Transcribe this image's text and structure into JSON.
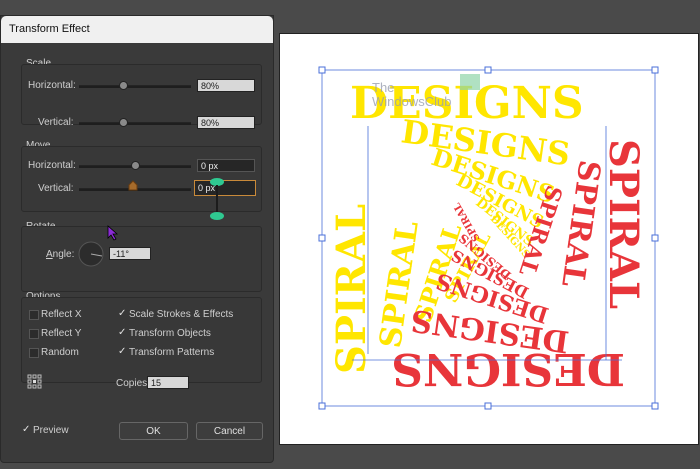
{
  "dialog": {
    "title": "Transform Effect",
    "scale": {
      "group_label": "Scale",
      "horizontal_label": "Horizontal:",
      "horizontal_value": "80%",
      "horizontal_fraction": 0.8,
      "vertical_label": "Vertical:",
      "vertical_value": "80%",
      "vertical_fraction": 0.8
    },
    "move": {
      "group_label": "Move",
      "horizontal_label": "Horizontal:",
      "horizontal_value": "0 px",
      "vertical_label": "Vertical:",
      "vertical_value": "0 px"
    },
    "rotate": {
      "group_label": "Rotate",
      "angle_label": "Angle:",
      "angle_value": "-11°"
    },
    "options": {
      "group_label": "Options",
      "reflect_x": "Reflect X",
      "reflect_y": "Reflect Y",
      "random": "Random",
      "scale_strokes": "Scale Strokes & Effects",
      "transform_objects": "Transform Objects",
      "transform_patterns": "Transform Patterns",
      "copies_label": "Copies",
      "copies_value": "15"
    },
    "preview_label": "Preview",
    "ok_label": "OK",
    "cancel_label": "Cancel"
  },
  "artwork": {
    "top_text": "DESIGNS",
    "bottom_text": "DESIGNS",
    "left_text": "SPIRAL",
    "right_text": "SPIRAL",
    "spiral_words": [
      "DESIGNS",
      "SPIRAL"
    ],
    "watermark_line1": "The",
    "watermark_line2": "WindowsClub",
    "colors": {
      "yellow": "#ffe600",
      "red": "#e8353a",
      "selection": "#4a6fd8"
    }
  }
}
